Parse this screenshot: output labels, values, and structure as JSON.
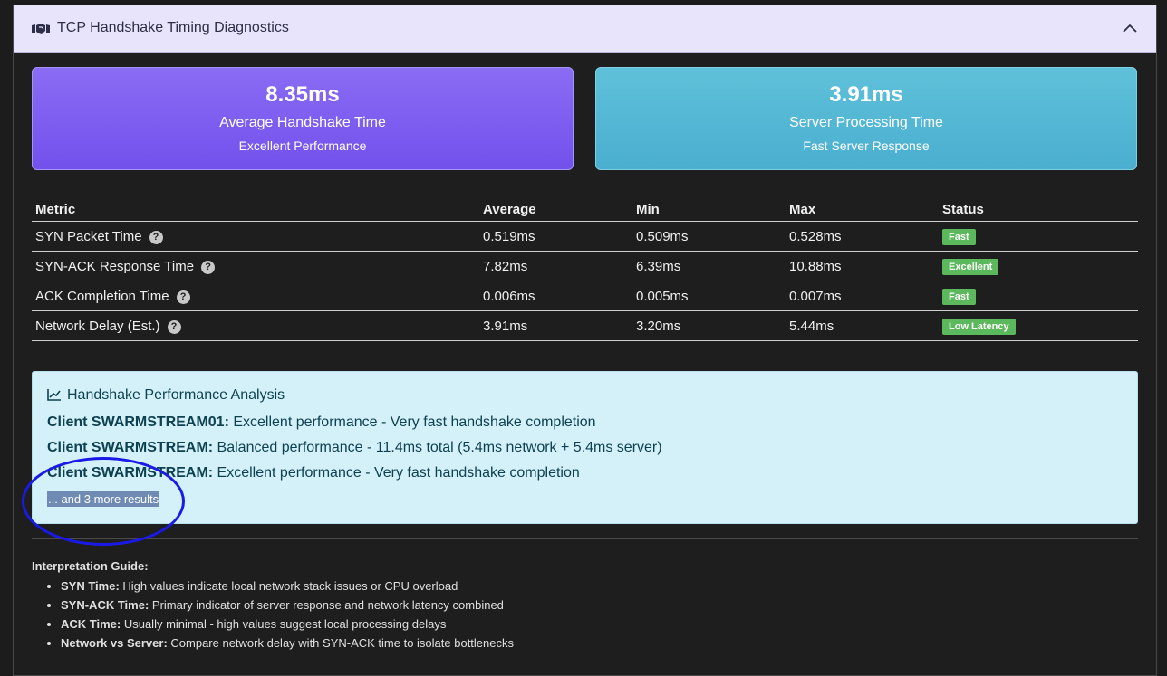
{
  "header": {
    "title": "TCP Handshake Timing Diagnostics",
    "icon": "handshake-icon"
  },
  "cards": [
    {
      "value": "8.35ms",
      "label": "Average Handshake Time",
      "sub": "Excellent Performance",
      "color": "#7a5cf0"
    },
    {
      "value": "3.91ms",
      "label": "Server Processing Time",
      "sub": "Fast Server Response",
      "color": "#52b6d5"
    }
  ],
  "table": {
    "headers": [
      "Metric",
      "Average",
      "Min",
      "Max",
      "Status"
    ],
    "rows": [
      {
        "metric": "SYN Packet Time",
        "avg": "0.519ms",
        "min": "0.509ms",
        "max": "0.528ms",
        "status": "Fast"
      },
      {
        "metric": "SYN-ACK Response Time",
        "avg": "7.82ms",
        "min": "6.39ms",
        "max": "10.88ms",
        "status": "Excellent"
      },
      {
        "metric": "ACK Completion Time",
        "avg": "0.006ms",
        "min": "0.005ms",
        "max": "0.007ms",
        "status": "Fast"
      },
      {
        "metric": "Network Delay (Est.)",
        "avg": "3.91ms",
        "min": "3.20ms",
        "max": "5.44ms",
        "status": "Low Latency"
      }
    ]
  },
  "analysis": {
    "title": "Handshake Performance Analysis",
    "lines": [
      {
        "client": "Client SWARMSTREAM01:",
        "text": " Excellent performance - Very fast handshake completion"
      },
      {
        "client": "Client SWARMSTREAM:",
        "text": " Balanced performance - 11.4ms total (5.4ms network + 5.4ms server)"
      },
      {
        "client": "Client SWARMSTREAM:",
        "text": " Excellent performance - Very fast handshake completion"
      }
    ],
    "more": "... and 3 more results"
  },
  "guide": {
    "title": "Interpretation Guide:",
    "items": [
      {
        "term": "SYN Time:",
        "text": " High values indicate local network stack issues or CPU overload"
      },
      {
        "term": "SYN-ACK Time:",
        "text": " Primary indicator of server response and network latency combined"
      },
      {
        "term": "ACK Time:",
        "text": " Usually minimal - high values suggest local processing delays"
      },
      {
        "term": "Network vs Server:",
        "text": " Compare network delay with SYN-ACK time to isolate bottlenecks"
      }
    ]
  },
  "colors": {
    "badge": "#5cb85c",
    "annotation_circle": "#1a1ae6",
    "analysis_bg": "#d4f1f9"
  }
}
